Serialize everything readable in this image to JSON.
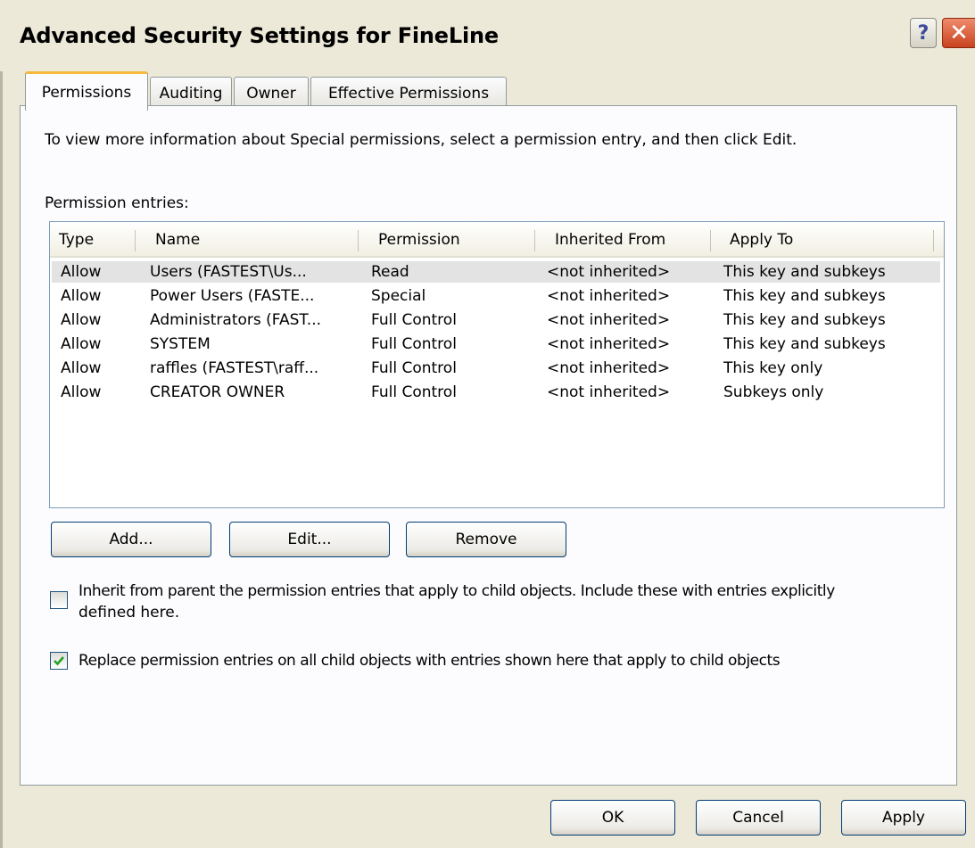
{
  "window": {
    "title": "Advanced Security Settings for FineLine",
    "help_glyph": "?",
    "close_glyph": "✕"
  },
  "tabs": [
    {
      "label": "Permissions",
      "active": true
    },
    {
      "label": "Auditing",
      "active": false
    },
    {
      "label": "Owner",
      "active": false
    },
    {
      "label": "Effective Permissions",
      "active": false
    }
  ],
  "permissions_tab": {
    "info_text": "To view more information about Special permissions, select a permission entry, and then click Edit.",
    "entries_label": "Permission entries:",
    "columns": [
      "Type",
      "Name",
      "Permission",
      "Inherited From",
      "Apply To"
    ],
    "entries": [
      [
        "Allow",
        "Users (FASTEST\\Us...",
        "Read",
        "<not inherited>",
        "This key and subkeys"
      ],
      [
        "Allow",
        "Power Users (FASTE...",
        "Special",
        "<not inherited>",
        "This key and subkeys"
      ],
      [
        "Allow",
        "Administrators (FAST...",
        "Full Control",
        "<not inherited>",
        "This key and subkeys"
      ],
      [
        "Allow",
        "SYSTEM",
        "Full Control",
        "<not inherited>",
        "This key and subkeys"
      ],
      [
        "Allow",
        "raffles (FASTEST\\raff...",
        "Full Control",
        "<not inherited>",
        "This key only"
      ],
      [
        "Allow",
        "CREATOR OWNER",
        "Full Control",
        "<not inherited>",
        "Subkeys only"
      ]
    ],
    "selected_row": 0,
    "add_label": "Add...",
    "edit_label": "Edit...",
    "remove_label": "Remove",
    "inherit_checkbox": {
      "label_line1": "Inherit from parent the permission entries that apply to child objects. Include these with entries explicitly",
      "label_line2": "defined here.",
      "checked": false
    },
    "replace_checkbox": {
      "label": "Replace permission entries on all child objects with entries shown here that apply to child objects",
      "checked": true
    }
  },
  "footer": {
    "ok_label": "OK",
    "cancel_label": "Cancel",
    "apply_label": "Apply"
  },
  "colors": {
    "window_bg": "#ece9d8",
    "tab_highlight": "#f5b93b",
    "check_mark": "#21a121"
  }
}
